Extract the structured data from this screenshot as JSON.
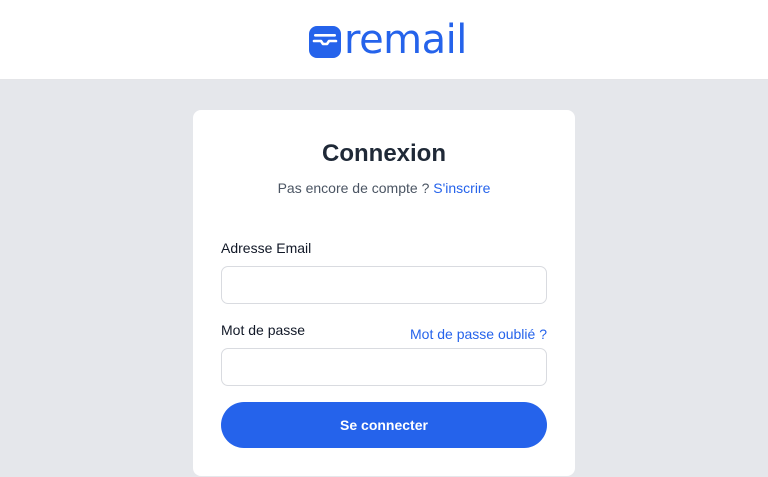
{
  "brand": {
    "name": "remail",
    "icon": "inbox-tray-icon",
    "color": "#2563eb"
  },
  "login": {
    "title": "Connexion",
    "signup_prompt": "Pas encore de compte ? ",
    "signup_link": "S'inscrire",
    "email_label": "Adresse Email",
    "email_value": "",
    "email_placeholder": "",
    "password_label": "Mot de passe",
    "password_value": "",
    "password_placeholder": "",
    "forgot_link": "Mot de passe oublié ?",
    "submit_label": "Se connecter"
  },
  "colors": {
    "accent": "#2563eb",
    "page_background": "#e5e7eb",
    "card_background": "#ffffff"
  }
}
